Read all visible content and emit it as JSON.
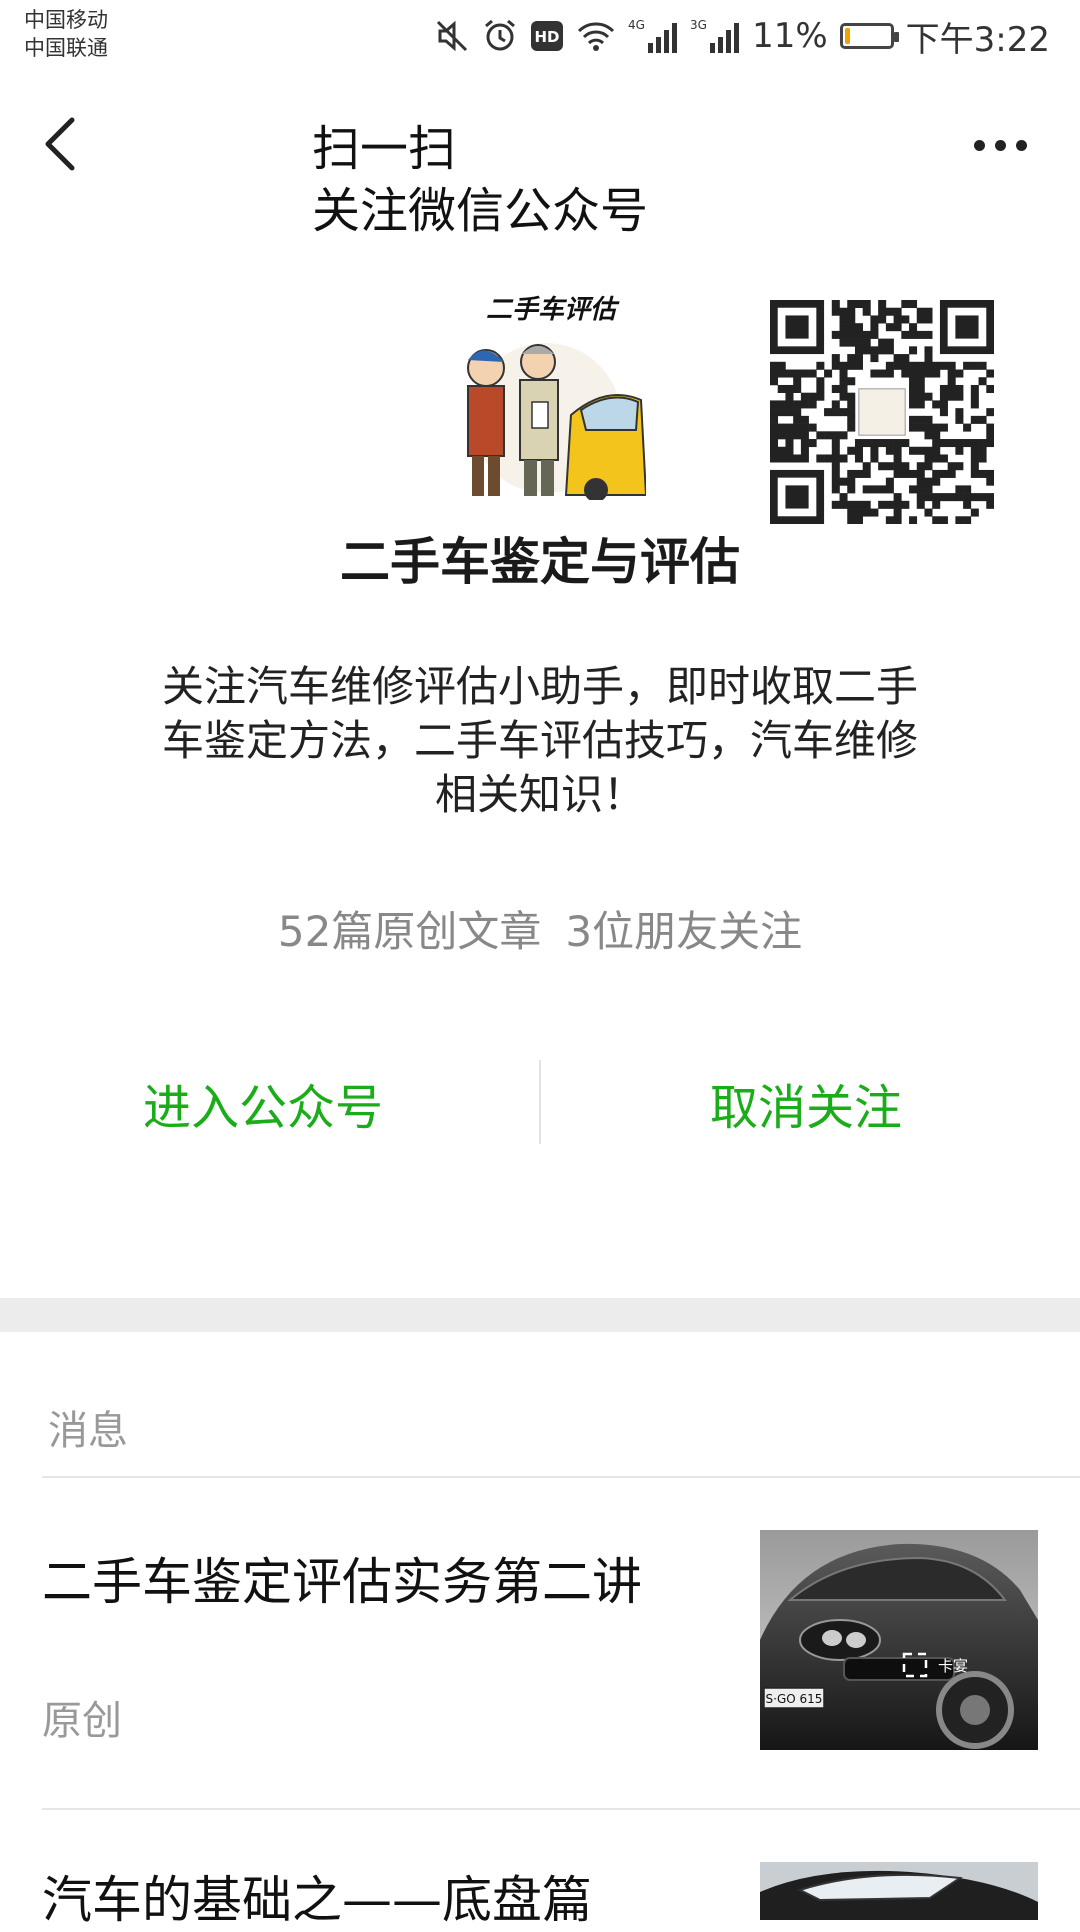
{
  "status_bar": {
    "carrier_1": "中国移动",
    "carrier_2": "中国联通",
    "icons": [
      "mute-icon",
      "alarm-icon",
      "hd-icon",
      "wifi-icon",
      "signal-4g-icon",
      "signal-3g-icon",
      "battery-icon"
    ],
    "battery_percent": "11%",
    "battery_level": 0.11,
    "time": "下午3:22"
  },
  "header": {
    "title_line1": "扫一扫",
    "title_line2": "关注微信公众号",
    "back_icon": "chevron-left-icon",
    "more_icon": "more-dots-icon"
  },
  "profile": {
    "avatar_caption": "二手车评估",
    "name": "二手车鉴定与评估",
    "description": "关注汽车维修评估小助手，即时收取二手车鉴定方法，二手车评估技巧，汽车维修相关知识！",
    "original_articles": "52篇原创文章",
    "friends_following": "3位朋友关注"
  },
  "actions": {
    "enter_label": "进入公众号",
    "unfollow_label": "取消关注",
    "accent_color": "#1aad19"
  },
  "messages": {
    "section_label": "消息",
    "items": [
      {
        "title": "二手车鉴定评估实务第二讲",
        "tag": "原创",
        "thumb_plate": "S·GO 615",
        "thumb_watermark": "卡宴"
      },
      {
        "title": "汽车的基础之——底盘篇"
      }
    ]
  }
}
